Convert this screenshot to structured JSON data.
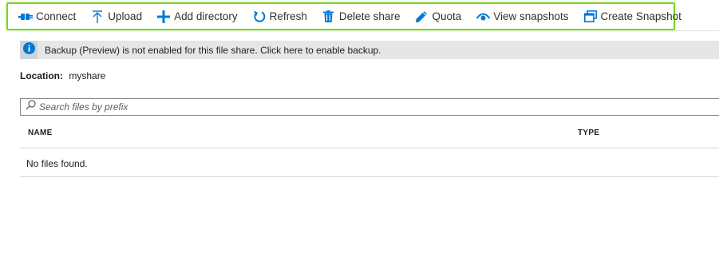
{
  "toolbar": {
    "items": [
      {
        "icon": "connect-icon",
        "label": "Connect"
      },
      {
        "icon": "upload-icon",
        "label": "Upload"
      },
      {
        "icon": "plus-icon",
        "label": "Add directory"
      },
      {
        "icon": "refresh-icon",
        "label": "Refresh"
      },
      {
        "icon": "trash-icon",
        "label": "Delete share"
      },
      {
        "icon": "pencil-icon",
        "label": "Quota"
      },
      {
        "icon": "eye-icon",
        "label": "View snapshots"
      },
      {
        "icon": "snapshot-icon",
        "label": "Create Snapshot"
      }
    ],
    "highlight_color": "#7ed321",
    "icon_color": "#0078d4"
  },
  "banner": {
    "icon": "info-icon",
    "text": "Backup (Preview) is not enabled for this file share. Click here to enable backup."
  },
  "location": {
    "label": "Location:",
    "value": "myshare"
  },
  "search": {
    "placeholder": "Search files by prefix",
    "value": ""
  },
  "table": {
    "columns": [
      "NAME",
      "TYPE"
    ],
    "empty_message": "No files found."
  }
}
